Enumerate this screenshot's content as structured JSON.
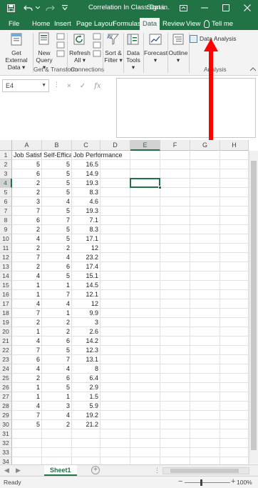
{
  "window": {
    "title": "Correlation In Class Data...",
    "sign_in": "Sign in",
    "minimize_icon": "minimize-icon",
    "maximize_icon": "maximize-icon",
    "close_icon": "close-icon",
    "ribbon_display_icon": "ribbon-display-options-icon"
  },
  "ribbon_tabs": [
    "File",
    "Home",
    "Insert",
    "Page Layout",
    "Formulas",
    "Data",
    "Review",
    "View"
  ],
  "active_tab": "Data",
  "tell_me": "Tell me",
  "ribbon": {
    "get_external_data": {
      "line1": "Get External",
      "line2": "Data ▾"
    },
    "new_query": {
      "line1": "New",
      "line2": "Query ▾"
    },
    "refresh_all": {
      "line1": "Refresh",
      "line2": "All ▾"
    },
    "sort_filter": {
      "line1": "Sort &",
      "line2": "Filter ▾"
    },
    "data_tools": {
      "line1": "Data",
      "line2": "Tools ▾"
    },
    "forecast": {
      "line1": "Forecast",
      "line2": "▾"
    },
    "outline": {
      "line1": "Outline",
      "line2": "▾"
    },
    "data_analysis": "Data Analysis",
    "group_get_transform": "Get & Transform",
    "group_connections": "Connections",
    "group_analysis": "Analysis"
  },
  "formula_bar": {
    "name_box": "E4",
    "cancel_icon": "×",
    "enter_icon": "✓",
    "fx": "fx",
    "formula": ""
  },
  "grid": {
    "columns": [
      "A",
      "B",
      "C",
      "D",
      "E",
      "F",
      "G",
      "H"
    ],
    "selected_column": "E",
    "selected_row": 4,
    "header_row": [
      "Job Satisfaction",
      "Self-Efficacy",
      "Job Performance"
    ],
    "rows": [
      [
        5,
        5,
        16.5
      ],
      [
        6,
        5,
        14.9
      ],
      [
        2,
        5,
        19.3
      ],
      [
        2,
        5,
        8.3
      ],
      [
        3,
        4,
        4.6
      ],
      [
        7,
        5,
        19.3
      ],
      [
        6,
        7,
        7.1
      ],
      [
        2,
        5,
        8.3
      ],
      [
        4,
        5,
        17.1
      ],
      [
        2,
        2,
        12
      ],
      [
        7,
        4,
        23.2
      ],
      [
        2,
        6,
        17.4
      ],
      [
        4,
        5,
        15.1
      ],
      [
        1,
        1,
        14.5
      ],
      [
        1,
        7,
        12.1
      ],
      [
        4,
        4,
        12
      ],
      [
        7,
        1,
        9.9
      ],
      [
        2,
        2,
        3
      ],
      [
        1,
        2,
        2.6
      ],
      [
        4,
        6,
        14.2
      ],
      [
        7,
        5,
        12.3
      ],
      [
        6,
        7,
        13.1
      ],
      [
        4,
        4,
        8
      ],
      [
        2,
        6,
        6.4
      ],
      [
        1,
        5,
        2.9
      ],
      [
        1,
        1,
        1.5
      ],
      [
        4,
        3,
        5.9
      ],
      [
        7,
        4,
        19.2
      ],
      [
        5,
        2,
        21.2
      ]
    ],
    "total_rows_visible": 34
  },
  "sheet_tabs": [
    "Sheet1"
  ],
  "status": {
    "ready": "Ready",
    "zoom": "100%"
  },
  "colors": {
    "excel_green": "#217346",
    "annotation_red": "#ff0000"
  }
}
